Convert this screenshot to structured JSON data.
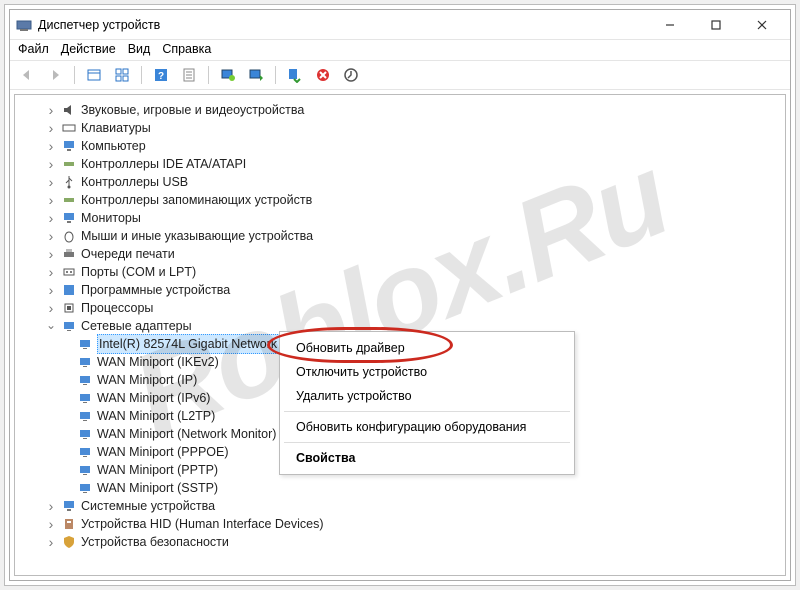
{
  "window": {
    "title": "Диспетчер устройств"
  },
  "menubar": {
    "file": "Файл",
    "action": "Действие",
    "view": "Вид",
    "help": "Справка"
  },
  "tree": {
    "audio": "Звуковые, игровые и видеоустройства",
    "keyboards": "Клавиатуры",
    "computer": "Компьютер",
    "ide": "Контроллеры IDE ATA/ATAPI",
    "usb": "Контроллеры USB",
    "storage": "Контроллеры запоминающих устройств",
    "monitors": "Мониторы",
    "mice": "Мыши и иные указывающие устройства",
    "printq": "Очереди печати",
    "ports": "Порты (COM и LPT)",
    "software": "Программные устройства",
    "cpus": "Процессоры",
    "netadapters": "Сетевые адаптеры",
    "net": {
      "intel": "Intel(R) 82574L Gigabit Network Connection",
      "ikev2": "WAN Miniport (IKEv2)",
      "ip": "WAN Miniport (IP)",
      "ipv6": "WAN Miniport (IPv6)",
      "l2tp": "WAN Miniport (L2TP)",
      "netmon": "WAN Miniport (Network Monitor)",
      "pppoe": "WAN Miniport (PPPOE)",
      "pptp": "WAN Miniport (PPTP)",
      "sstp": "WAN Miniport (SSTP)"
    },
    "system": "Системные устройства",
    "hid": "Устройства HID (Human Interface Devices)",
    "security": "Устройства безопасности"
  },
  "context_menu": {
    "update_driver": "Обновить драйвер",
    "disable_device": "Отключить устройство",
    "uninstall_device": "Удалить устройство",
    "scan_hardware": "Обновить конфигурацию оборудования",
    "properties": "Свойства"
  },
  "watermark": "Roblox.Ru"
}
